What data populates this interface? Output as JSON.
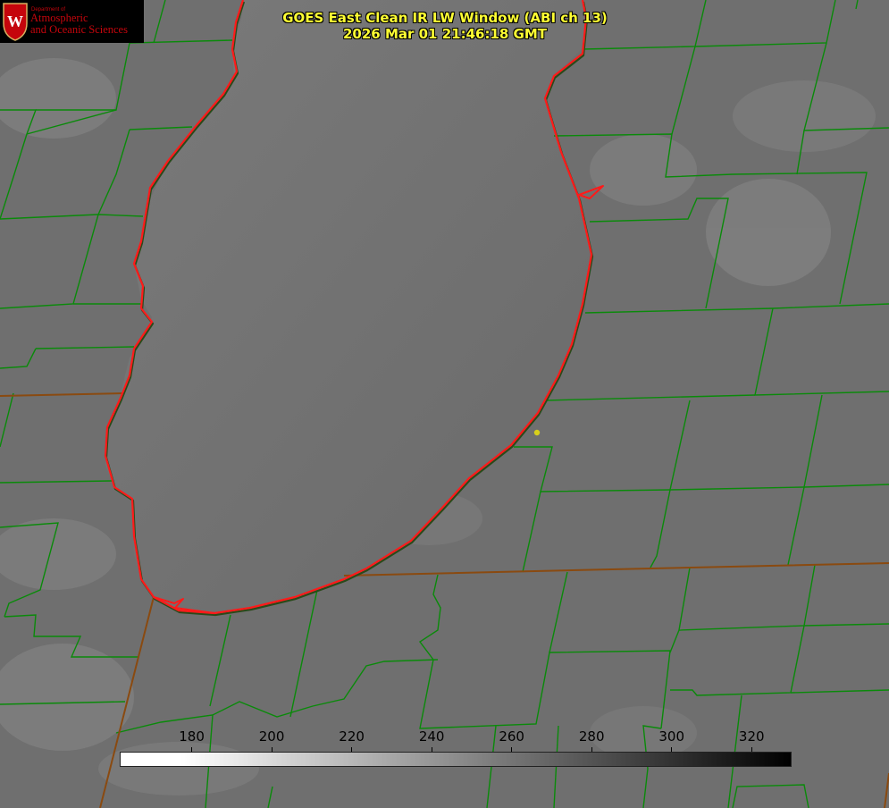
{
  "logo": {
    "department": "Department of",
    "line1": "Atmospheric",
    "line2": "and Oceanic Sciences",
    "crest_letter": "W",
    "color": "#c5050c",
    "icon": "uw-crest-icon"
  },
  "title": {
    "line1": "GOES East Clean IR LW Window (ABI ch 13)",
    "line2": "2026 Mar 01 21:46:18 GMT",
    "color": "#ffff33"
  },
  "colorbar": {
    "ticks": [
      {
        "label": "180",
        "value": 180
      },
      {
        "label": "200",
        "value": 200
      },
      {
        "label": "220",
        "value": 220
      },
      {
        "label": "240",
        "value": 240
      },
      {
        "label": "260",
        "value": 260
      },
      {
        "label": "280",
        "value": 280
      },
      {
        "label": "300",
        "value": 300
      },
      {
        "label": "320",
        "value": 320
      }
    ],
    "range": [
      162,
      330
    ],
    "from_color": "#ffffff",
    "to_color": "#000000"
  },
  "map": {
    "county_color": "#0a8a0a",
    "state_color": "#8a4a10",
    "coast_color": "#ff1a1a",
    "marker_color": "#d8d01a"
  }
}
